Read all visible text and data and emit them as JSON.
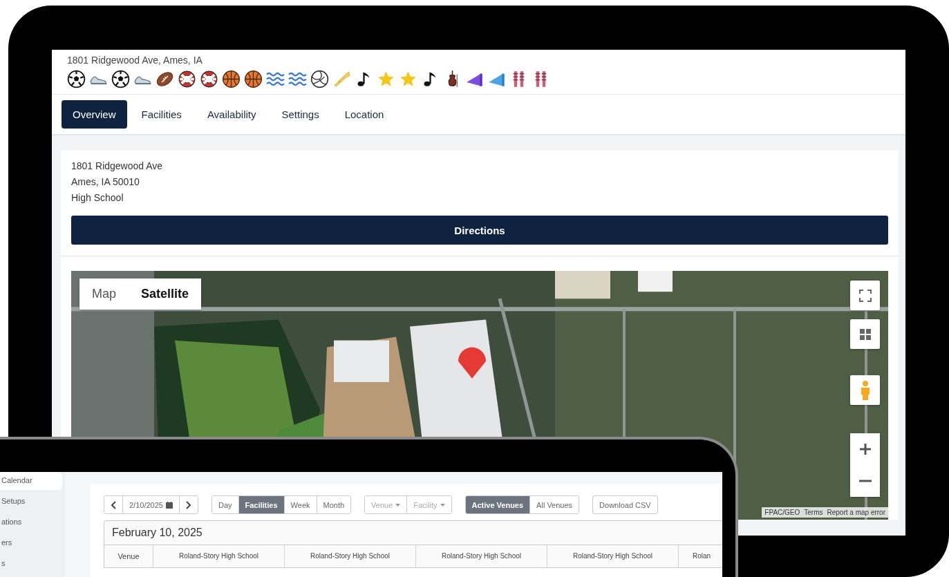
{
  "venue": {
    "address": "1801 Ridgewood Ave, Ames, IA",
    "tabs": [
      {
        "label": "Overview",
        "selected": true
      },
      {
        "label": "Facilities",
        "selected": false
      },
      {
        "label": "Availability",
        "selected": false
      },
      {
        "label": "Settings",
        "selected": false
      },
      {
        "label": "Location",
        "selected": false
      }
    ],
    "overview": {
      "address_lines": [
        "1801 Ridgewood Ave",
        "Ames, IA 50010",
        "High School"
      ],
      "directions_button": "Directions"
    },
    "map": {
      "kind": "picture",
      "type_buttons": [
        {
          "label": "Map",
          "selected": false
        },
        {
          "label": "Satellite",
          "selected": true
        }
      ],
      "attribution": [
        "FPAC/GEO",
        "Terms",
        "Report a map error"
      ]
    }
  },
  "calendar_app": {
    "sidebar": {
      "items": [
        {
          "label": "Calendar",
          "selected": true
        },
        {
          "label": "Setups",
          "selected": false
        },
        {
          "label": "ations",
          "selected": false
        },
        {
          "label": "ers",
          "selected": false
        },
        {
          "label": "s",
          "selected": false
        }
      ]
    },
    "toolbar": {
      "date": "2/10/2025",
      "views": [
        {
          "label": "Day",
          "selected": false
        },
        {
          "label": "Facilities",
          "selected": true
        },
        {
          "label": "Week",
          "selected": false
        },
        {
          "label": "Month",
          "selected": false
        }
      ],
      "filters": [
        {
          "placeholder": "Venue",
          "disabled": true
        },
        {
          "placeholder": "Facility",
          "disabled": true
        }
      ],
      "venue_scope": [
        {
          "label": "Active Venues",
          "selected": true
        },
        {
          "label": "All Venues",
          "selected": false
        }
      ],
      "download_button": "Download CSV"
    },
    "table": {
      "title": "February 10, 2025",
      "columns": [
        "Venue",
        "Roland-Story High School",
        "Roland-Story High School",
        "Roland-Story High School",
        "Roland-Story High School",
        "Rolan"
      ]
    }
  }
}
